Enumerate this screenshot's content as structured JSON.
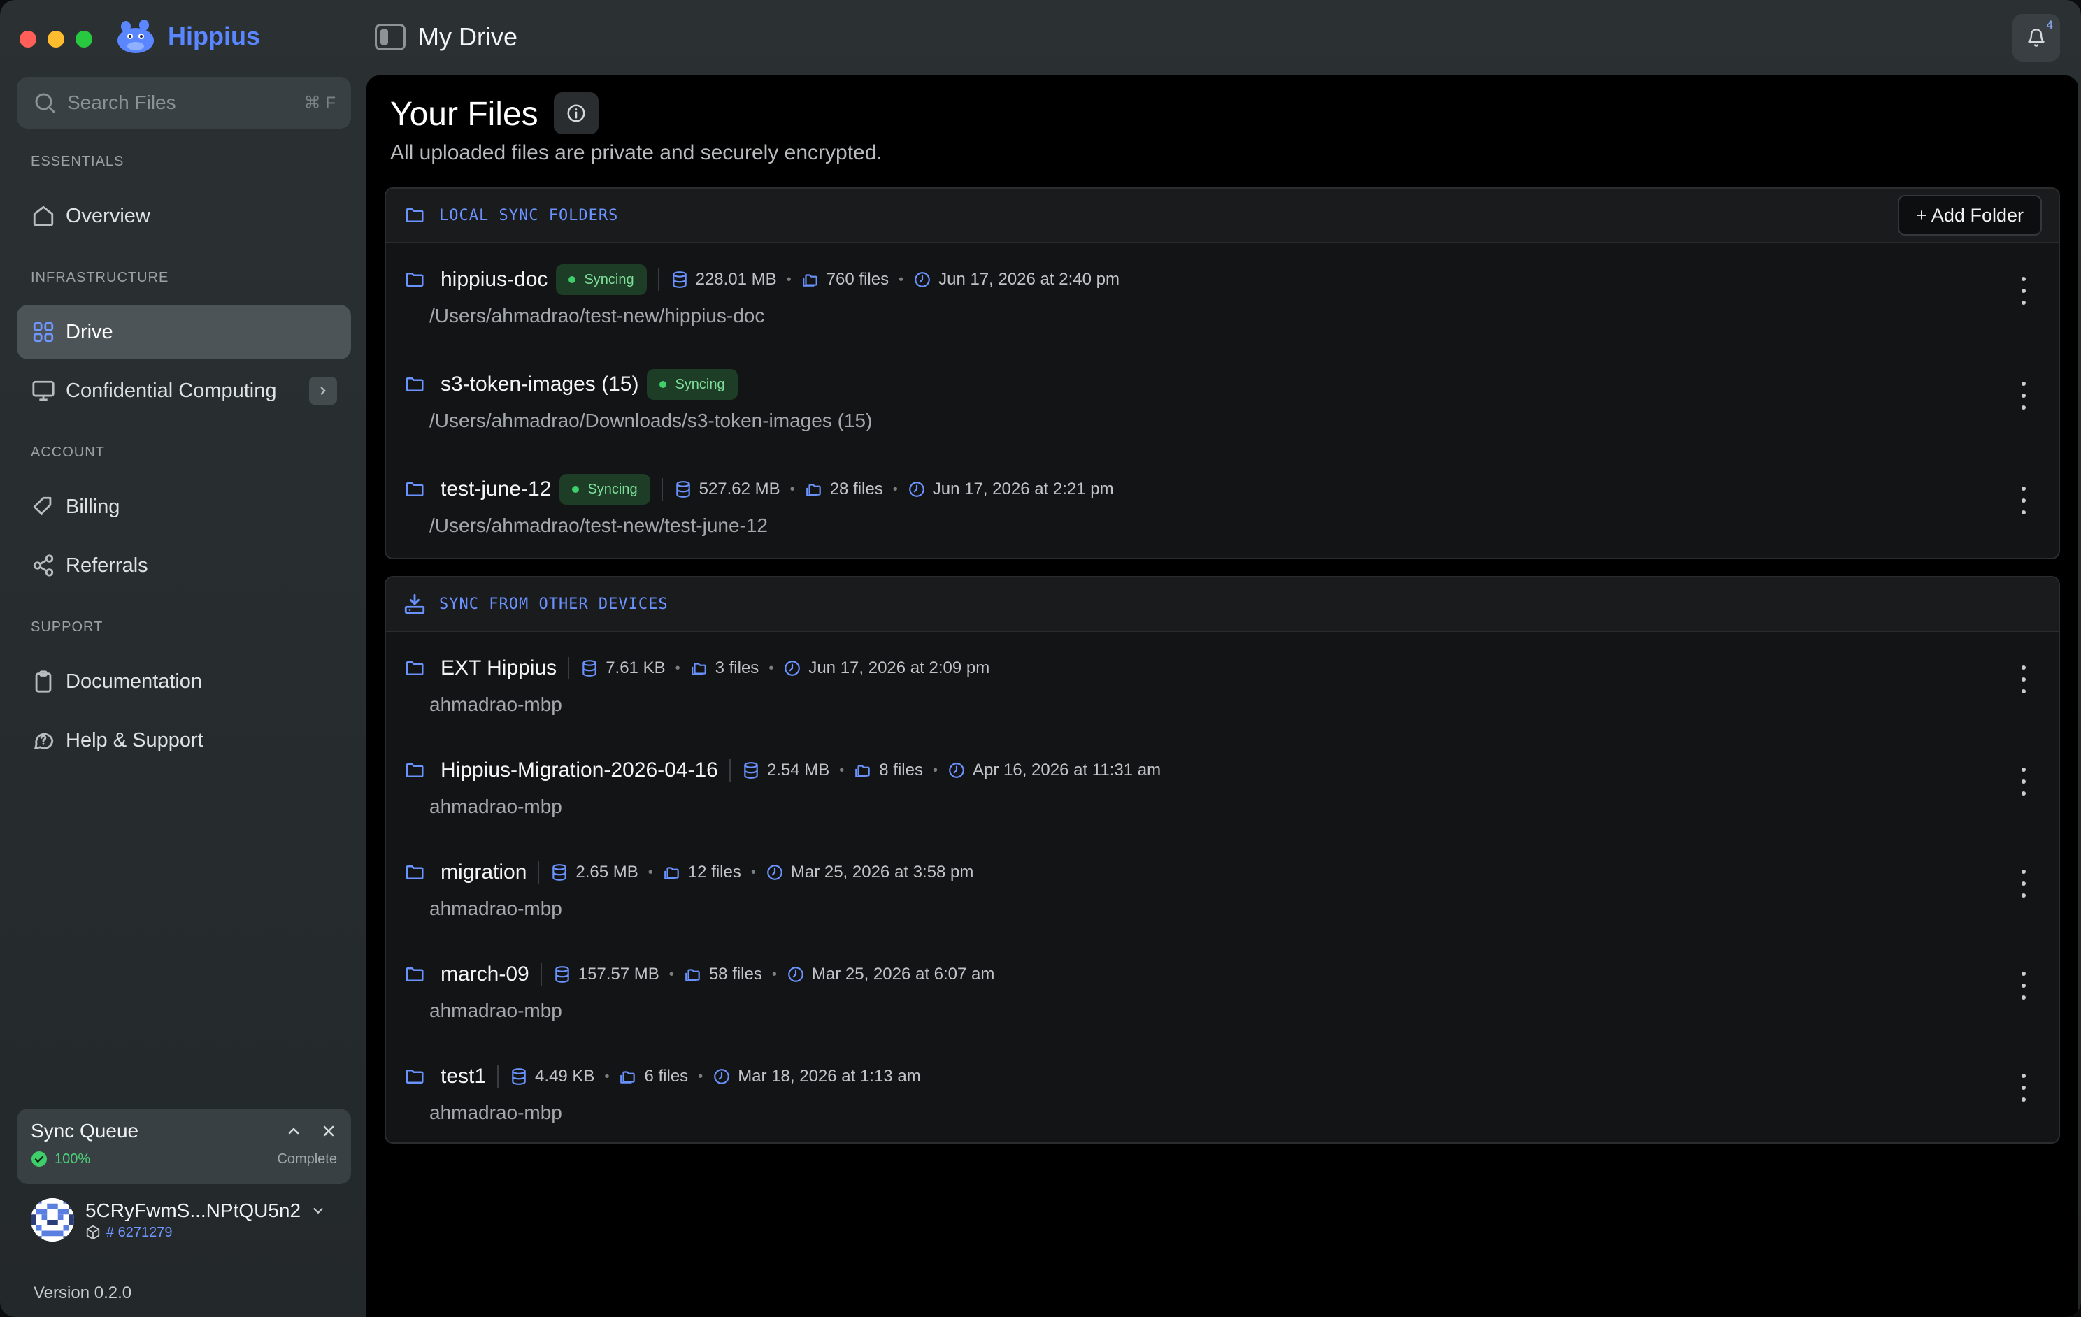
{
  "app": {
    "name": "Hippius",
    "page": "My Drive",
    "notifications": "4"
  },
  "search": {
    "placeholder": "Search Files",
    "shortcut": "⌘ F"
  },
  "sidebar": {
    "sections": {
      "essentials": "ESSENTIALS",
      "infrastructure": "INFRASTRUCTURE",
      "account": "ACCOUNT",
      "support": "SUPPORT"
    },
    "items": {
      "overview": "Overview",
      "drive": "Drive",
      "confidential": "Confidential Computing",
      "billing": "Billing",
      "referrals": "Referrals",
      "documentation": "Documentation",
      "help": "Help & Support"
    }
  },
  "sync_queue": {
    "title": "Sync Queue",
    "percent": "100%",
    "status": "Complete"
  },
  "account": {
    "name": "5CRyFwmS...NPtQU5n2",
    "id": "# 6271279"
  },
  "version": "Version 0.2.0",
  "main": {
    "title": "Your Files",
    "subtitle": "All uploaded files are private and securely encrypted.",
    "local": {
      "label": "LOCAL SYNC FOLDERS",
      "add_button": "+ Add Folder",
      "rows": [
        {
          "name": "hippius-doc",
          "badge": "Syncing",
          "size": "228.01 MB",
          "files": "760 files",
          "date": "Jun 17, 2026 at 2:40 pm",
          "path": "/Users/ahmadrao/test-new/hippius-doc"
        },
        {
          "name": "s3-token-images (15)",
          "badge": "Syncing",
          "path": "/Users/ahmadrao/Downloads/s3-token-images (15)"
        },
        {
          "name": "test-june-12",
          "badge": "Syncing",
          "size": "527.62 MB",
          "files": "28 files",
          "date": "Jun 17, 2026 at 2:21 pm",
          "path": "/Users/ahmadrao/test-new/test-june-12"
        }
      ]
    },
    "devices": {
      "label": "SYNC FROM OTHER DEVICES",
      "rows": [
        {
          "name": "EXT Hippius",
          "size": "7.61 KB",
          "files": "3 files",
          "date": "Jun 17, 2026 at 2:09 pm",
          "device": "ahmadrao-mbp"
        },
        {
          "name": "Hippius-Migration-2026-04-16",
          "size": "2.54 MB",
          "files": "8 files",
          "date": "Apr 16, 2026 at 11:31 am",
          "device": "ahmadrao-mbp"
        },
        {
          "name": "migration",
          "size": "2.65 MB",
          "files": "12 files",
          "date": "Mar 25, 2026 at 3:58 pm",
          "device": "ahmadrao-mbp"
        },
        {
          "name": "march-09",
          "size": "157.57 MB",
          "files": "58 files",
          "date": "Mar 25, 2026 at 6:07 am",
          "device": "ahmadrao-mbp"
        },
        {
          "name": "test1",
          "size": "4.49 KB",
          "files": "6 files",
          "date": "Mar 18, 2026 at 1:13 am",
          "device": "ahmadrao-mbp"
        }
      ]
    }
  },
  "colors": {
    "accent": "#5a86ff",
    "syncing_bg": "#1d3d27",
    "syncing_text": "#7fe09a",
    "success": "#4cd07a"
  },
  "icons": [
    "search-icon",
    "home-icon",
    "grid-icon",
    "monitor-icon",
    "chevron-right-icon",
    "tag-icon",
    "share-icon",
    "clipboard-icon",
    "help-icon",
    "bell-icon",
    "folder-icon",
    "database-icon",
    "files-icon",
    "clock-icon",
    "info-icon",
    "download-device-icon",
    "more-vertical-icon",
    "chevron-up-icon",
    "close-icon",
    "chevron-down-icon",
    "box-icon",
    "check-circle-icon"
  ]
}
